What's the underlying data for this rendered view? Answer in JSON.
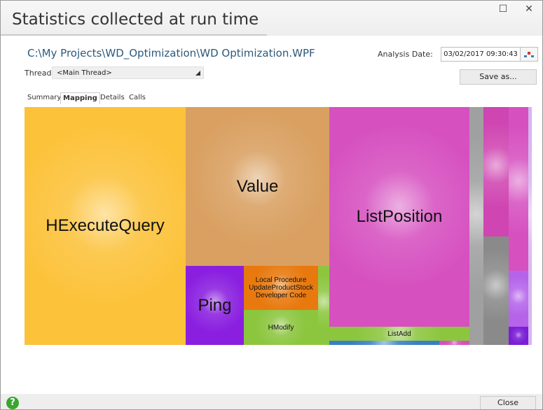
{
  "window": {
    "title": "Statistics collected at run time",
    "maximize_glyph": "☐",
    "close_glyph": "✕"
  },
  "header": {
    "file_path": "C:\\My Projects\\WD_Optimization\\WD Optimization.WPF",
    "analysis_date_label": "Analysis Date:",
    "analysis_date_value": "03/02/2017 09:30:43",
    "thread_label": "Thread:",
    "thread_value": "<Main Thread>",
    "save_as_label": "Save as..."
  },
  "tabs": [
    {
      "label": "Summary",
      "active": false
    },
    {
      "label": "Mapping",
      "active": true
    },
    {
      "label": "Details",
      "active": false
    },
    {
      "label": "Calls",
      "active": false
    }
  ],
  "treemap": {
    "cells": [
      {
        "label": "HExecuteQuery",
        "color": "#fcc23a"
      },
      {
        "label": "Value",
        "color": "#d9a061"
      },
      {
        "label": "Ping",
        "color": "#8a1fe0"
      },
      {
        "label": "Local Procedure\nUpdateProductStock\nDeveloper Code",
        "color": "#e8790e"
      },
      {
        "label": "HModify",
        "color": "#8cc63f"
      },
      {
        "label": "",
        "color": "#8cc63f"
      },
      {
        "label": "ListPosition",
        "color": "#d650c0"
      },
      {
        "label": "ListAdd",
        "color": "#8cc63f"
      },
      {
        "label": "",
        "color": "#3a7fc4"
      },
      {
        "label": "",
        "color": "#d650c0"
      },
      {
        "label": "",
        "color": "#a0a0a0"
      },
      {
        "label": "",
        "color": "#8a8a8a"
      },
      {
        "label": "",
        "color": "#cf45b1"
      },
      {
        "label": "",
        "color": "#d650c0"
      },
      {
        "label": "",
        "color": "#e062c8"
      },
      {
        "label": "",
        "color": "#b564ea"
      },
      {
        "label": "",
        "color": "#7a1fd6"
      },
      {
        "label": "",
        "color": "#d7b4f0"
      }
    ]
  },
  "footer": {
    "help_glyph": "?",
    "close_label": "Close"
  }
}
